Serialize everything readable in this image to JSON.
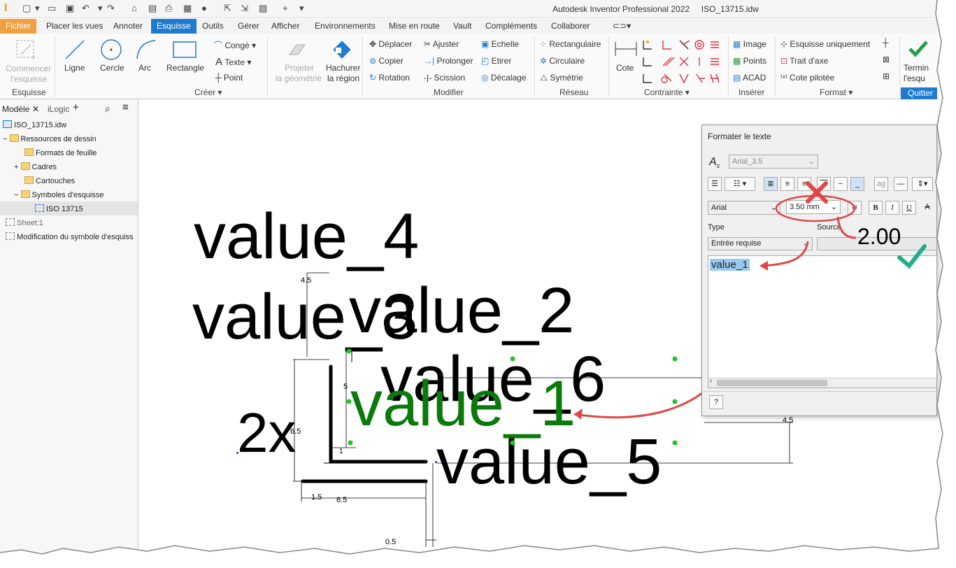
{
  "window": {
    "title": "Autodesk Inventor Professional 2022     ISO_13715.idw"
  },
  "tabs": [
    "Fichier",
    "Placer les vues",
    "Annoter",
    "Esquisse",
    "Outils",
    "Gérer",
    "Afficher",
    "Environnements",
    "Mise en route",
    "Vault",
    "Compléments",
    "Collaborer"
  ],
  "ribbon": {
    "esquisse": {
      "start_label_1": "Commencer",
      "start_label_2": "l'esquisse",
      "group": "Esquisse"
    },
    "creer": {
      "ligne": "Ligne",
      "cercle": "Cercle",
      "arc": "Arc",
      "rectangle": "Rectangle",
      "conge": "Congé",
      "texte": "Texte",
      "point": "Point",
      "group": "Créer"
    },
    "projeter": {
      "label_1": "Projeter",
      "label_2": "la géométrie"
    },
    "hachurer": {
      "label_1": "Hachurer",
      "label_2": "la région"
    },
    "modifier": {
      "deplacer": "Déplacer",
      "copier": "Copier",
      "rotation": "Rotation",
      "ajuster": "Ajuster",
      "prolonger": "Prolonger",
      "scission": "Scission",
      "echelle": "Echelle",
      "etirer": "Etirer",
      "decalage": "Décalage",
      "group": "Modifier"
    },
    "reseau": {
      "rectangulaire": "Rectangulaire",
      "circulaire": "Circulaire",
      "symetrie": "Symétrie",
      "group": "Réseau"
    },
    "contrainte": {
      "cote": "Cote",
      "group": "Contrainte"
    },
    "inserer": {
      "image": "Image",
      "points": "Points",
      "acad": "ACAD",
      "group": "Insérer"
    },
    "format": {
      "esquisse_uniquement": "Esquisse uniquement",
      "trait_axe": "Trait d'axe",
      "cote_pilotee": "Cote pilotée",
      "group": "Format"
    },
    "quitter": {
      "label_1": "Termin",
      "label_2": "l'esqu",
      "group": "Quitter"
    }
  },
  "browser": {
    "tab_model": "Modèle",
    "tab_ilogic": "iLogic",
    "items": [
      "ISO_13715.idw",
      "Ressources de dessin",
      "Formats de feuille",
      "Cadres",
      "Cartouches",
      "Symboles d'esquisse",
      "ISO 13715",
      "Sheet:1",
      "Modification du symbole d'esquiss"
    ]
  },
  "canvas": {
    "texts": {
      "v4": "value_4",
      "v3": "value_3",
      "v2": "value_2",
      "v6": "value_6",
      "v1": "value_1",
      "v5": "value_5",
      "twox": "2x"
    },
    "dims": {
      "d45a": "4.5",
      "d5": "5",
      "d65": "6.5",
      "d1": "1",
      "d15": "1.5",
      "d65b": "6.5",
      "d45b": "4.5",
      "d05": "0.5"
    },
    "annotation": "2.00"
  },
  "dialog": {
    "title": "Formater le texte",
    "style_value": "Arial_3.5",
    "font_value": "Arial",
    "size_value": "3.50 mm",
    "type_label": "Type",
    "source_label": "Source",
    "type_value": "Entrée requise",
    "text_content": "value_1",
    "bold": "B",
    "italic": "I",
    "underline": "U",
    "help": "?"
  },
  "colors": {
    "accent": "#1e7bd0",
    "file_tab": "#f0a03c",
    "highlight_text": "#0a7a0a",
    "annotation_red": "#e04848",
    "check_green": "#1fae8a"
  }
}
